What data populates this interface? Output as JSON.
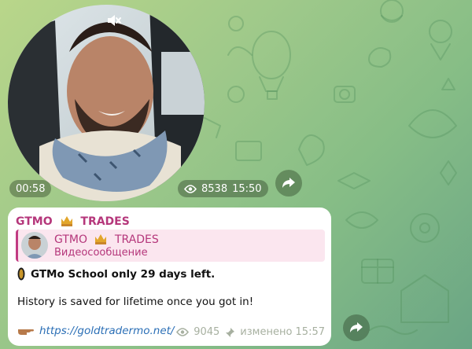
{
  "video_message": {
    "duration": "00:58",
    "views": "8538",
    "time": "15:50",
    "icons": {
      "mute": "mute-icon",
      "views": "eye-icon",
      "share": "share-icon"
    }
  },
  "message": {
    "sender": {
      "name_left": "GTMO",
      "name_right": "TRADES",
      "emoji": "crown-icon"
    },
    "reply": {
      "name_left": "GTMO",
      "name_right": "TRADES",
      "subtitle": "Видеосообщение"
    },
    "line1": "GTMo School only 29 days left.",
    "line2": "History is saved for lifetime once you got in!",
    "link": "https://goldtradermo.net/",
    "footer": {
      "views": "9045",
      "edited": "изменено 15:57"
    },
    "icons": {
      "coin": "coin-icon",
      "pointer": "pointing-hand-icon",
      "pin": "pin-icon"
    }
  },
  "colors": {
    "sender": "#b5377b",
    "link": "#2b6fb6",
    "reply_background": "#fbe6ef",
    "meta_text": "#a7b0a0"
  }
}
